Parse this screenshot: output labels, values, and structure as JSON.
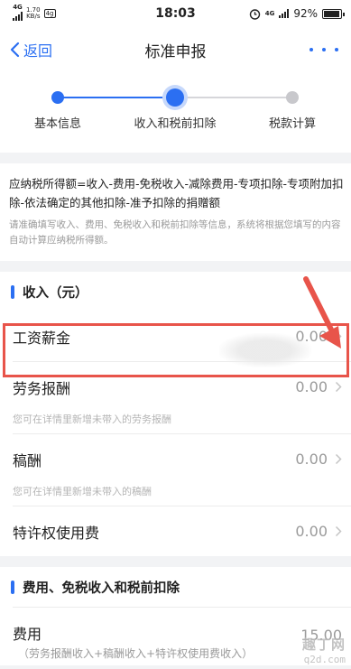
{
  "status_bar": {
    "network": "4G",
    "speed_value": "1.70",
    "speed_unit": "KB/s",
    "badge": "4g",
    "time": "18:03",
    "network_right": "4G",
    "battery": "92%"
  },
  "nav": {
    "back_label": "返回",
    "title": "标准申报"
  },
  "stepper": {
    "steps": [
      {
        "label": "基本信息",
        "state": "done"
      },
      {
        "label": "收入和税前扣除",
        "state": "current"
      },
      {
        "label": "税款计算",
        "state": "todo"
      }
    ]
  },
  "info": {
    "formula": "应纳税所得额=收入-费用-免税收入-减除费用-专项扣除-专项附加扣除-依法确定的其他扣除-准予扣除的捐赠额",
    "note": "请准确填写收入、费用、免税收入和税前扣除等信息，系统将根据您填写的内容自动计算应纳税所得额。"
  },
  "income_section": {
    "title": "收入（元）",
    "rows": [
      {
        "label": "工资薪金",
        "value": "0.00",
        "hint": ""
      },
      {
        "label": "劳务报酬",
        "value": "0.00",
        "hint": "您可在详情里新增未带入的劳务报酬"
      },
      {
        "label": "稿酬",
        "value": "0.00",
        "hint": "您可在详情里新增未带入的稿酬"
      },
      {
        "label": "特许权使用费",
        "value": "0.00",
        "hint": ""
      }
    ]
  },
  "deduction_section": {
    "title": "费用、免税收入和税前扣除",
    "rows": [
      {
        "label": "费用",
        "sub": "（劳务报酬收入+稿酬收入+特许权使用费收入）",
        "value": "15.00"
      }
    ]
  },
  "watermark": {
    "line1": "趣丁网",
    "line2": "q2d.com"
  },
  "colors": {
    "accent": "#2b6ff2",
    "highlight": "#e8544a"
  }
}
